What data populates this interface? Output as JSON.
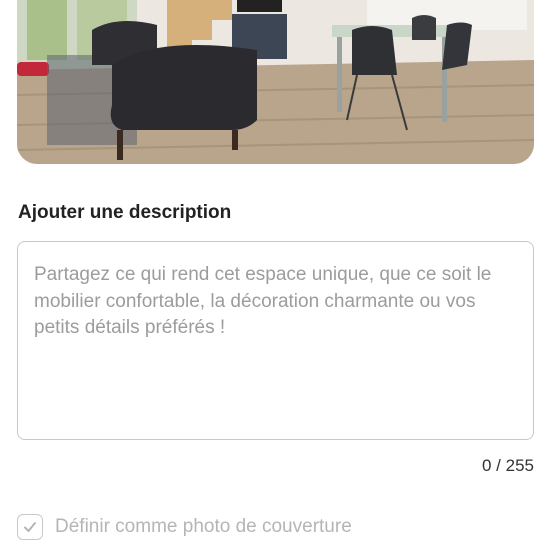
{
  "description": {
    "title": "Ajouter une description",
    "placeholder": "Partagez ce qui rend cet espace unique, que ce soit le mobilier confortable, la décoration charmante ou vos petits détails préférés !",
    "counter": "0 / 255"
  },
  "cover": {
    "label": "Définir comme photo de couverture",
    "checked": true
  },
  "colors": {
    "border": "#c9c9c9",
    "placeholder": "#9c9c9c",
    "disabled_text": "#b5b5b5"
  }
}
